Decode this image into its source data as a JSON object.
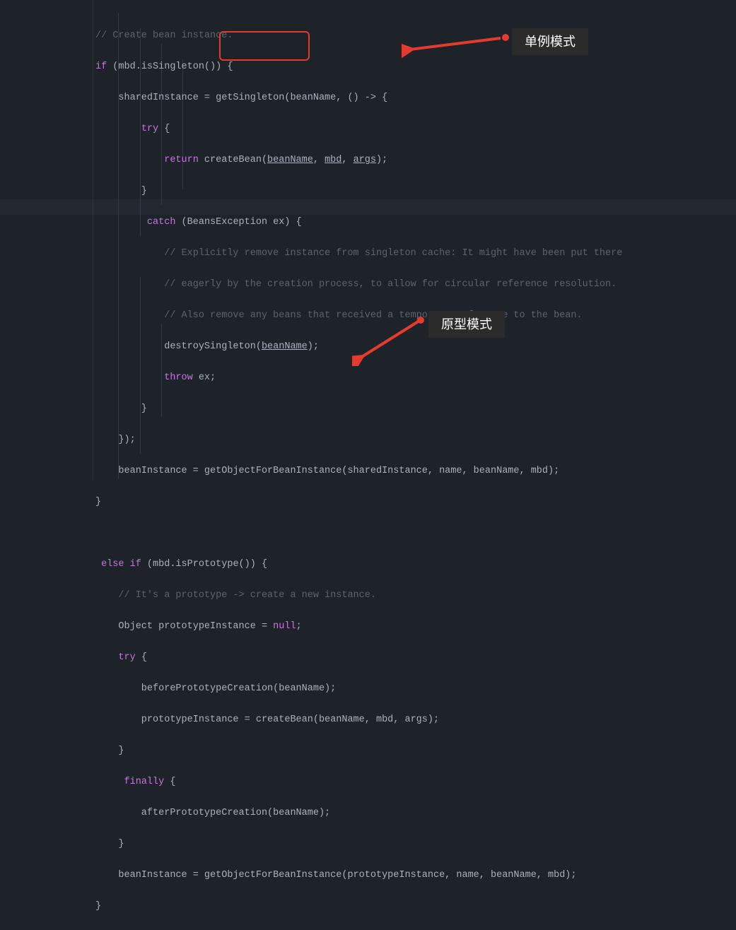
{
  "code": {
    "l1": "// Create bean instance.",
    "l2a": "if",
    "l2b": " (mbd.isSingleton()) {",
    "l3": "    sharedInstance = getSingleton(beanName, () -> {",
    "l4a": "        ",
    "l4b": "try",
    "l4c": " {",
    "l5a": "            ",
    "l5b": "return",
    "l5c": " createBean(",
    "l5d": "beanName",
    "l5e": ", ",
    "l5f": "mbd",
    "l5g": ", ",
    "l5h": "args",
    "l5i": ");",
    "l6": "        }",
    "l7a": "         ",
    "l7b": "catch",
    "l7c": " (BeansException ex) {",
    "l8": "            // Explicitly remove instance from singleton cache: It might have been put there",
    "l9": "            // eagerly by the creation process, to allow for circular reference resolution.",
    "l10": "            // Also remove any beans that received a temporary reference to the bean.",
    "l11a": "            destroySingleton(",
    "l11b": "beanName",
    "l11c": ");",
    "l12a": "            ",
    "l12b": "throw",
    "l12c": " ex;",
    "l13": "        }",
    "l14": "    });",
    "l15": "    beanInstance = getObjectForBeanInstance(sharedInstance, name, beanName, mbd);",
    "l16": "}",
    "l17": "",
    "l18a": " ",
    "l18b": "else if",
    "l18c": " (mbd.isPrototype()) {",
    "l19": "    // It's a prototype -> create a new instance.",
    "l20a": "    Object prototypeInstance = ",
    "l20b": "null",
    "l20c": ";",
    "l21a": "    ",
    "l21b": "try",
    "l21c": " {",
    "l22": "        beforePrototypeCreation(beanName);",
    "l23": "        prototypeInstance = createBean(beanName, mbd, args);",
    "l24": "    }",
    "l25a": "     ",
    "l25b": "finally",
    "l25c": " {",
    "l26": "        afterPrototypeCreation(beanName);",
    "l27": "    }",
    "l28": "    beanInstance = getObjectForBeanInstance(prototypeInstance, name, beanName, mbd);",
    "l29": "}"
  },
  "annotations": {
    "singleton_label": "单例模式",
    "prototype_label": "原型模式"
  },
  "colors": {
    "arrow": "#e43b2f",
    "highlight_box": "#e43b2f",
    "label_bg": "#2b2b2b"
  }
}
